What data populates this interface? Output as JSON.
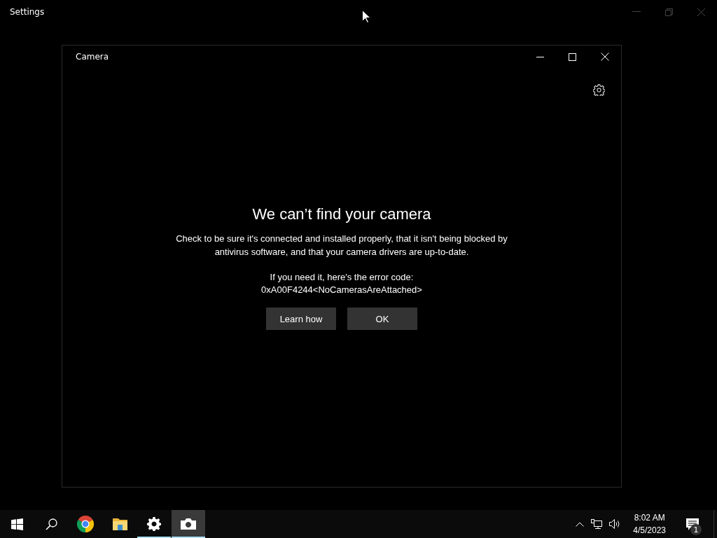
{
  "settings_window": {
    "title": "Settings"
  },
  "camera_window": {
    "title": "Camera",
    "dialog": {
      "heading": "We can’t find your camera",
      "message": "Check to be sure it's connected and installed properly, that it isn't being blocked by antivirus software, and that your camera drivers are up-to-date.",
      "error_intro": "If you need it, here's the error code:",
      "error_code": "0xA00F4244<NoCamerasAreAttached>",
      "buttons": [
        "Learn how",
        "OK"
      ]
    }
  },
  "taskbar": {
    "apps": [
      {
        "kind": "start",
        "running": false,
        "selected": false
      },
      {
        "kind": "search",
        "running": false,
        "selected": false
      },
      {
        "kind": "chrome",
        "running": false,
        "selected": false
      },
      {
        "kind": "folder",
        "running": false,
        "selected": false
      },
      {
        "kind": "settings",
        "running": true,
        "selected": false
      },
      {
        "kind": "camera",
        "running": true,
        "selected": true
      }
    ],
    "time": "8:02 AM",
    "date": "4/5/2023",
    "notification_count": "1"
  }
}
